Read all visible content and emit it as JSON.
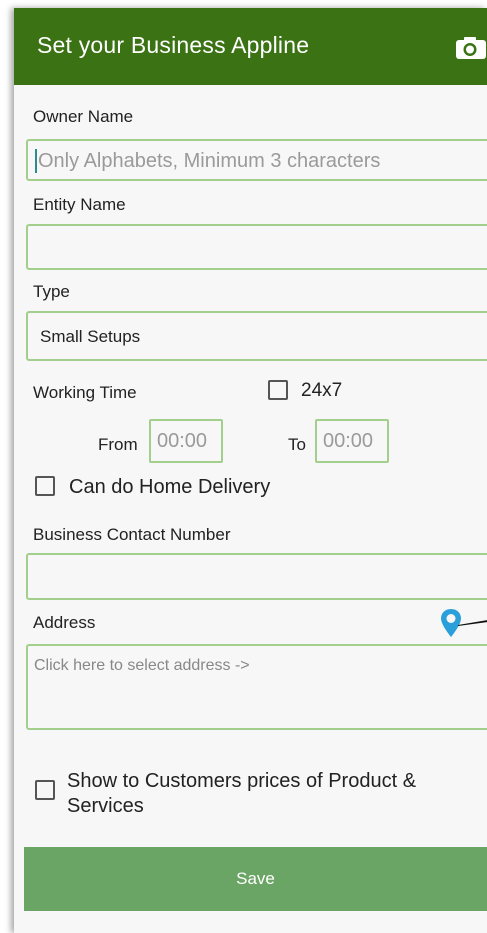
{
  "header": {
    "title": "Set your Business Appline",
    "camera_icon": "camera-icon"
  },
  "owner_name": {
    "label": "Owner Name",
    "placeholder": "Only Alphabets, Minimum 3 characters"
  },
  "entity_name": {
    "label": "Entity Name",
    "value": ""
  },
  "type": {
    "label": "Type",
    "value": "Small Setups"
  },
  "working_time": {
    "label": "Working Time",
    "always_open_label": "24x7",
    "from_label": "From",
    "from_placeholder": "00:00",
    "to_label": "To",
    "to_placeholder": "00:00"
  },
  "home_delivery": {
    "label": "Can do Home Delivery"
  },
  "contact": {
    "label": "Business Contact Number",
    "value": ""
  },
  "address": {
    "label": "Address",
    "placeholder": "Click here to select address ->",
    "pin_icon": "location-pin-icon"
  },
  "show_prices": {
    "label": "Show to Customers prices of Product & Services"
  },
  "save_button": {
    "label": "Save"
  },
  "colors": {
    "appbar": "#3b7214",
    "field_border": "#a3cf8c",
    "save_button": "#6aa565",
    "pin": "#2b9fd9"
  }
}
